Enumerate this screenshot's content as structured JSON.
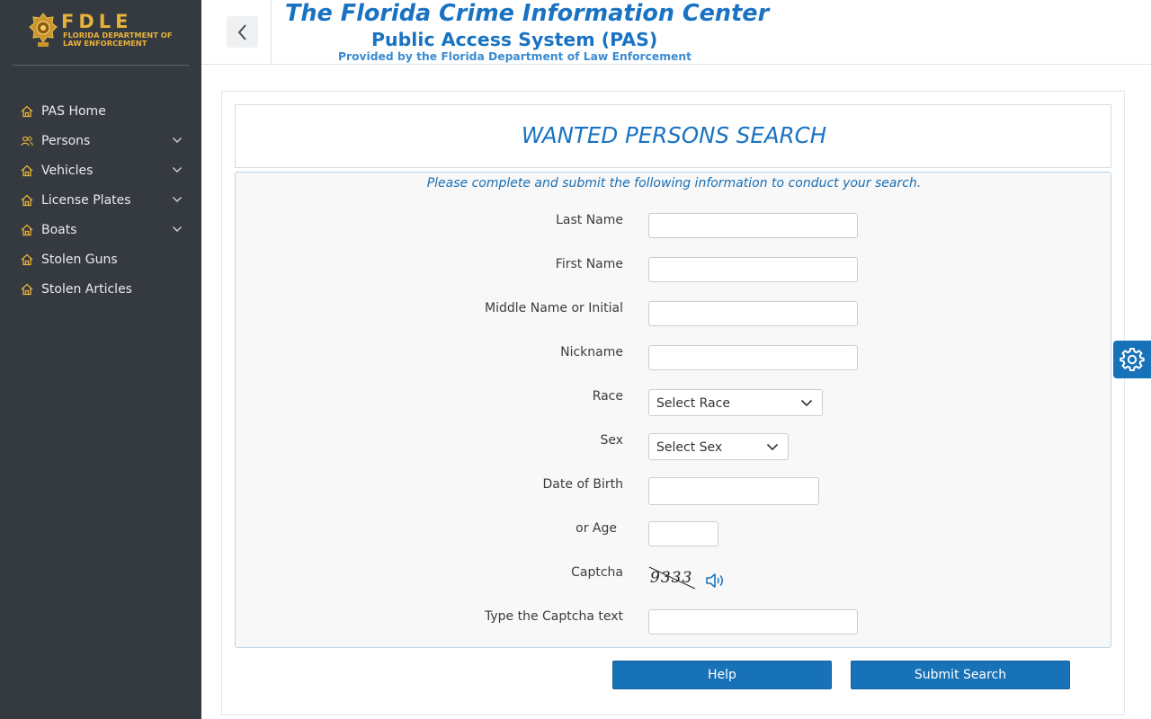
{
  "logo": {
    "title": "FDLE",
    "subtitle": "FLORIDA DEPARTMENT OF LAW ENFORCEMENT",
    "color": "#e8b23a"
  },
  "sidebar": {
    "items": [
      {
        "label": "PAS Home",
        "icon": "home-icon",
        "has_submenu": false
      },
      {
        "label": "Persons",
        "icon": "persons-icon",
        "has_submenu": true
      },
      {
        "label": "Vehicles",
        "icon": "home-icon",
        "has_submenu": true
      },
      {
        "label": "License Plates",
        "icon": "home-icon",
        "has_submenu": true
      },
      {
        "label": "Boats",
        "icon": "home-icon",
        "has_submenu": true
      },
      {
        "label": "Stolen Guns",
        "icon": "home-icon",
        "has_submenu": false
      },
      {
        "label": "Stolen Articles",
        "icon": "home-icon",
        "has_submenu": false
      }
    ]
  },
  "header": {
    "title": "The Florida Crime Information Center",
    "subtitle": "Public Access System (PAS)",
    "provided_by": "Provided by the Florida Department of Law Enforcement"
  },
  "main": {
    "page_title": "WANTED PERSONS SEARCH",
    "instructions": "Please complete and submit the following information to conduct your search."
  },
  "form": {
    "last_name": {
      "label": "Last Name",
      "value": "",
      "placeholder": ""
    },
    "first_name": {
      "label": "First Name",
      "value": "",
      "placeholder": ""
    },
    "middle_name": {
      "label": "Middle Name or Initial",
      "value": "",
      "placeholder": ""
    },
    "nickname": {
      "label": "Nickname",
      "value": "",
      "placeholder": ""
    },
    "race": {
      "label": "Race",
      "selected": "Select Race"
    },
    "sex": {
      "label": "Sex",
      "selected": "Select Sex"
    },
    "dob": {
      "label": "Date of Birth",
      "value": "",
      "placeholder": ""
    },
    "age": {
      "label": "or Age",
      "value": "",
      "placeholder": ""
    },
    "captcha": {
      "label": "Captcha",
      "image_text": "9333"
    },
    "captcha_input": {
      "label": "Type the Captcha text",
      "value": "",
      "placeholder": ""
    }
  },
  "buttons": {
    "help": "Help",
    "submit": "Submit Search"
  },
  "colors": {
    "sidebar_bg": "#353a40",
    "accent_blue": "#1a73c2",
    "button_blue": "#1872b8",
    "icon_gold": "#e8b23a"
  }
}
